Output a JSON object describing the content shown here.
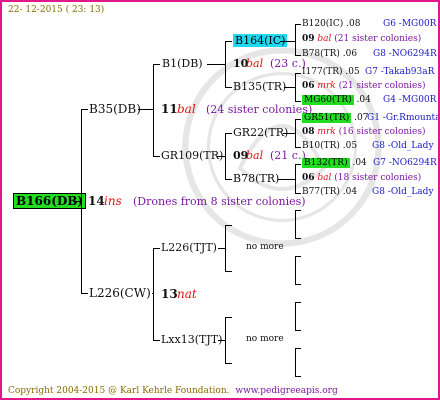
{
  "header": {
    "date": "22- 12-2015 ( 23: 13)"
  },
  "footer": {
    "copyright": "Copyright 2004-2015 @ Karl Kehrle Foundation.",
    "website": "www.pedigreeapis.org"
  },
  "root": {
    "label": "B166(DB)",
    "gen": "14",
    "breed": "ins",
    "note": "(Drones from 8 sister colonies)"
  },
  "sire_top": {
    "label": "B35(DB)",
    "gen": "11",
    "breed": "bal",
    "note": "(24 sister colonies)"
  },
  "sire_bottom": {
    "label": "L226(CW)",
    "gen": "13",
    "breed": "nat"
  },
  "gen3": {
    "b1": {
      "label": "B1(DB)",
      "gen": "10",
      "breed": "bal",
      "note": "(23 c.)"
    },
    "gr109": {
      "label": "GR109(TR)",
      "gen": "09",
      "breed": "bal",
      "note": "(21 c.)"
    },
    "l226": {
      "label": "L226(TJT)",
      "more": "no more"
    },
    "lxx13": {
      "label": "Lxx13(TJT)",
      "more": "no more"
    }
  },
  "gen4": {
    "b164": {
      "label": "B164(IC)"
    },
    "b135": {
      "label": "B135(TR)"
    },
    "gr22": {
      "label": "GR22(TR)"
    },
    "b78": {
      "label": "B78(TR)"
    }
  },
  "gen5": [
    {
      "label": "B120(IC)",
      "num": ".08",
      "right": "G6 -MG00R"
    },
    {
      "gen": "09",
      "breed": "bal",
      "note": "(21 sister colonies)"
    },
    {
      "label": "B78(TR)",
      "num": ".06",
      "right": "G8 -NO6294R"
    },
    {
      "label": "I177(TR)",
      "num": ".05",
      "right": "G7 -Takab93aR"
    },
    {
      "gen": "06",
      "breed": "mrk",
      "note": "(21 sister colonies)"
    },
    {
      "label": "MG60(TR)",
      "num": ".04",
      "right": "G4 -MG00R"
    },
    {
      "label": "GR51(TR)",
      "num": ".07",
      "right": "G1 -Gr.Rmounta"
    },
    {
      "gen": "08",
      "breed": "mrk",
      "note": "(16 sister colonies)"
    },
    {
      "label": "B10(TR)",
      "num": ".05",
      "right": "G8 -Old_Lady"
    },
    {
      "label": "B132(TR)",
      "num": ".04",
      "right": "G7 -NO6294R"
    },
    {
      "gen": "06",
      "breed": "bal",
      "note": "(18 sister colonies)"
    },
    {
      "label": "B77(TR)",
      "num": ".04",
      "right": "G8 -Old_Lady"
    }
  ],
  "colors": {
    "border": "#e0188a",
    "green": "#22dd22",
    "cyan": "#22d8ee",
    "red": "#e21212",
    "purple": "#7a18a0",
    "blue": "#1818c8",
    "gold": "#8a6a00"
  }
}
